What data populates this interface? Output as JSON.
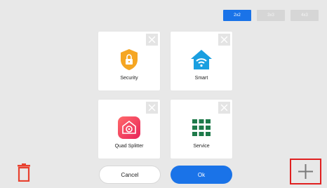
{
  "layout_tabs": [
    {
      "label": "2x2",
      "active": true
    },
    {
      "label": "3x3",
      "active": false
    },
    {
      "label": "4x3",
      "active": false
    }
  ],
  "tiles": [
    {
      "label": "Security",
      "icon": "lock-shield-icon",
      "color": "#f5a623"
    },
    {
      "label": "Smart",
      "icon": "wifi-home-icon",
      "color": "#1a9fe0"
    },
    {
      "label": "Quad Splitter",
      "icon": "camera-app-icon",
      "color": "#ff4d5c"
    },
    {
      "label": "Service",
      "icon": "grid-dots-icon",
      "color": "#1e7a4a"
    }
  ],
  "buttons": {
    "cancel": "Cancel",
    "ok": "Ok"
  },
  "colors": {
    "accent": "#1a73e8",
    "delete": "#e8412f",
    "highlight": "#e02020"
  }
}
